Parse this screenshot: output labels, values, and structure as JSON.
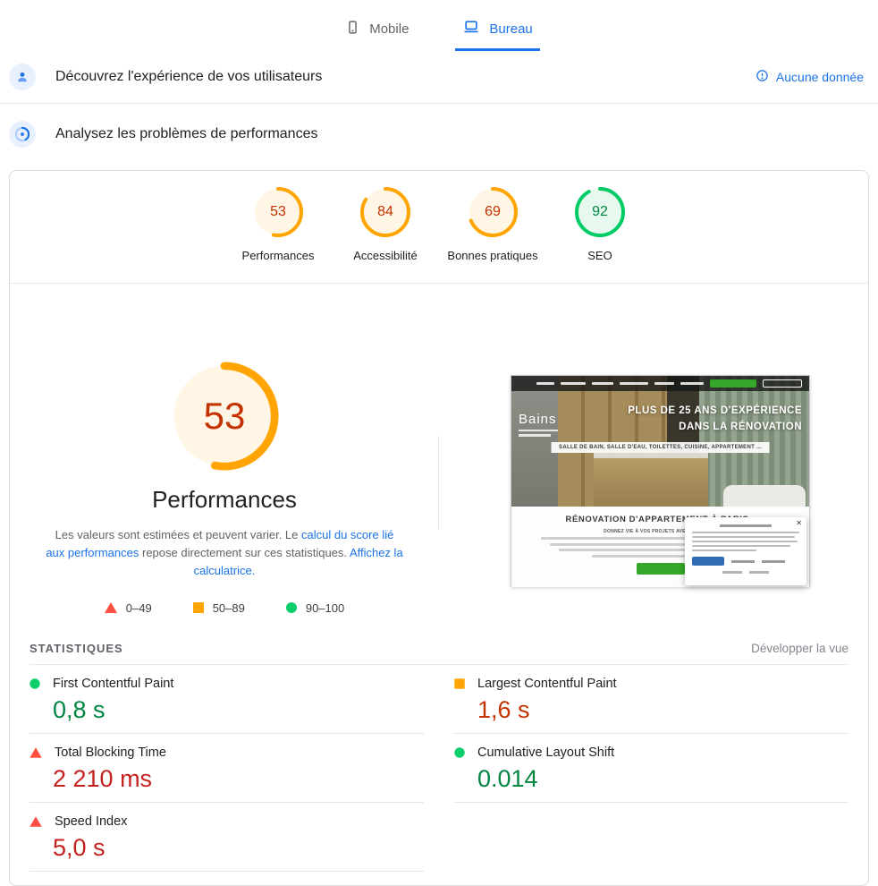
{
  "tabs": [
    {
      "label": "Mobile",
      "active": false
    },
    {
      "label": "Bureau",
      "active": true
    }
  ],
  "sections": {
    "experience": {
      "title": "Découvrez l'expérience de vos utilisateurs",
      "no_data_label": "Aucune donnée"
    },
    "analyze": {
      "title": "Analysez les problèmes de performances"
    }
  },
  "scores": [
    {
      "label": "Performances",
      "value": 53,
      "status": "average"
    },
    {
      "label": "Accessibilité",
      "value": 84,
      "status": "average"
    },
    {
      "label": "Bonnes pratiques",
      "value": 69,
      "status": "average"
    },
    {
      "label": "SEO",
      "value": 92,
      "status": "pass"
    }
  ],
  "performance_detail": {
    "value": 53,
    "status": "average",
    "title": "Performances",
    "desc_part1": "Les valeurs sont estimées et peuvent varier. Le ",
    "desc_link1": "calcul du score lié aux performances",
    "desc_part2": " repose directement sur ces statistiques. ",
    "desc_link2": "Affichez la calculatrice.",
    "legend": [
      {
        "range": "0–49",
        "status": "fail"
      },
      {
        "range": "50–89",
        "status": "average"
      },
      {
        "range": "90–100",
        "status": "pass"
      }
    ]
  },
  "thumbnail": {
    "logo": "Bains",
    "hero_title_line1": "PLUS DE 25 ANS D'EXPÉRIENCE",
    "hero_title_line2": "DANS LA RÉNOVATION",
    "hero_subtitle": "SALLE DE BAIN, SALLE D'EAU, TOILETTES, CUISINE, APPARTEMENT ...",
    "section_title": "RÉNOVATION D'APPARTEMENT À PARIS :",
    "section_subtitle": "DONNEZ VIE À VOS PROJETS AVEC LES BAINS"
  },
  "statistics": {
    "heading": "STATISTIQUES",
    "expand_label": "Développer la vue",
    "metrics": [
      {
        "name": "First Contentful Paint",
        "value": "0,8 s",
        "status": "pass"
      },
      {
        "name": "Largest Contentful Paint",
        "value": "1,6 s",
        "status": "average"
      },
      {
        "name": "Total Blocking Time",
        "value": "2 210 ms",
        "status": "fail"
      },
      {
        "name": "Cumulative Layout Shift",
        "value": "0.014",
        "status": "pass"
      },
      {
        "name": "Speed Index",
        "value": "5,0 s",
        "status": "fail"
      }
    ]
  },
  "colors": {
    "accent_blue": "#1a73e8",
    "pass_green": "#0cce6b",
    "pass_text": "#018642",
    "average_orange": "#ffa400",
    "average_text": "#c33300",
    "fail_red": "#ff4e42",
    "fail_text": "#c5221f"
  }
}
